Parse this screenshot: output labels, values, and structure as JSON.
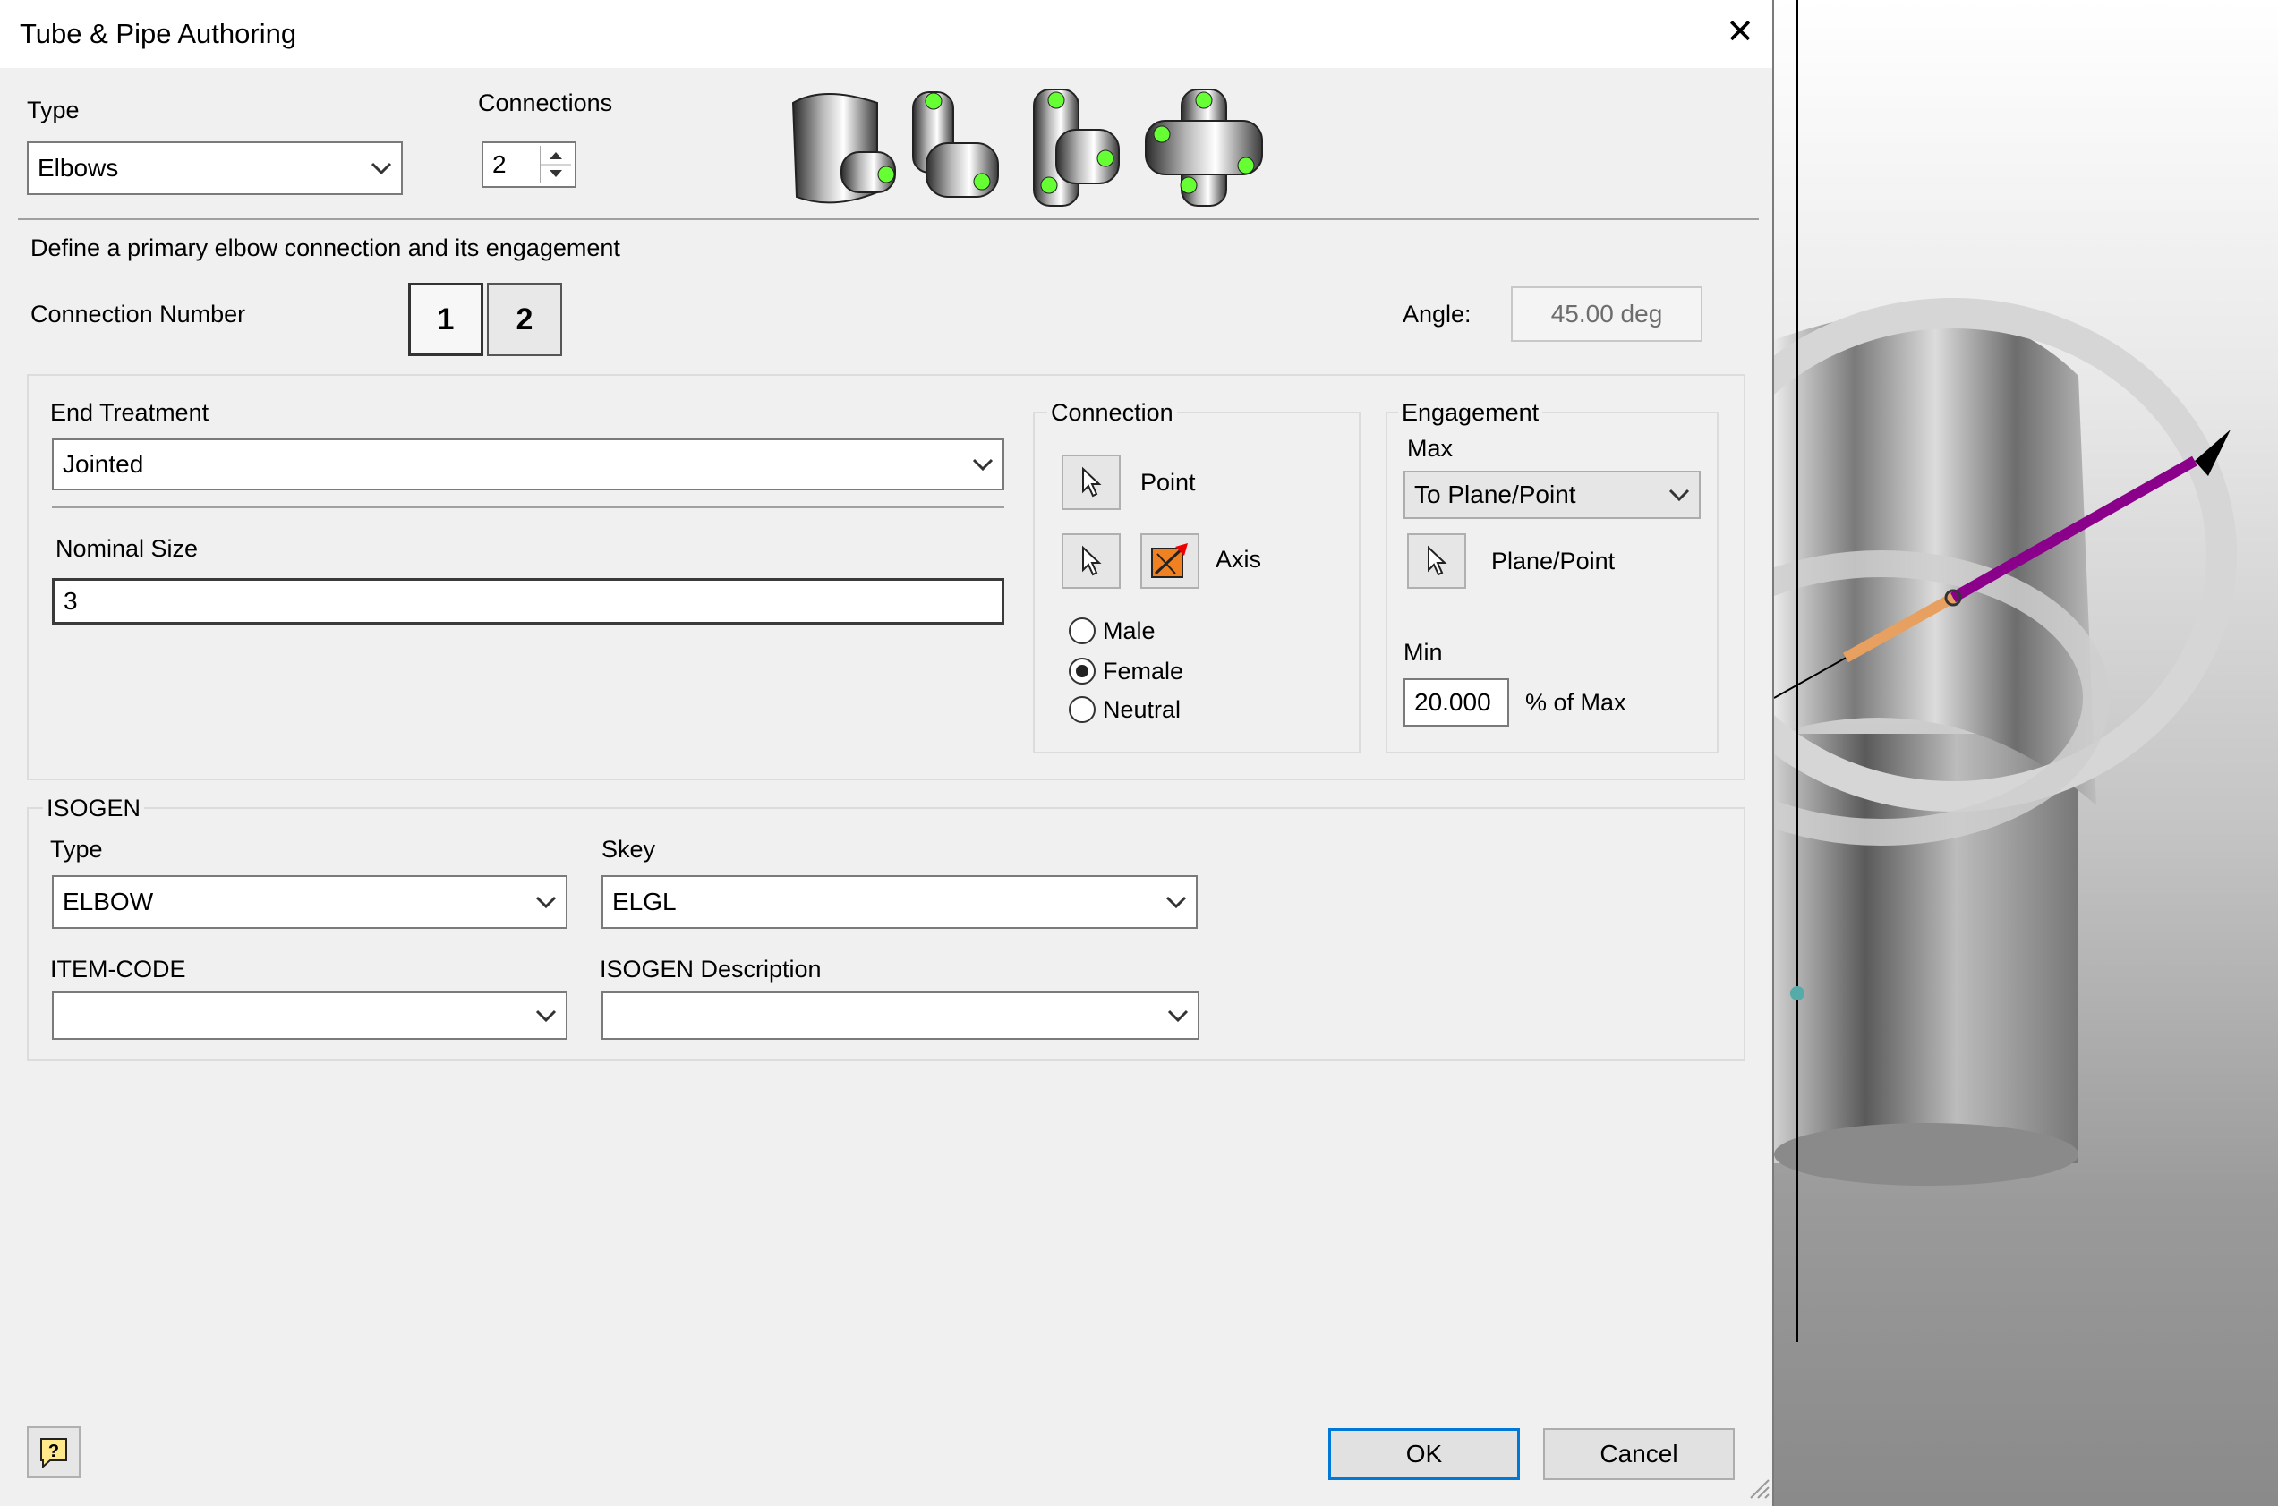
{
  "dialog": {
    "title": "Tube & Pipe Authoring",
    "type_label": "Type",
    "type_value": "Elbows",
    "connections_label": "Connections",
    "connections_value": "2",
    "instruction": "Define a primary elbow connection and its engagement",
    "connection_number_label": "Connection Number",
    "connection_numbers": [
      "1",
      "2"
    ],
    "selected_connection": "1",
    "angle_label": "Angle:",
    "angle_value": "45.00 deg"
  },
  "end_treatment": {
    "label": "End Treatment",
    "value": "Jointed",
    "nominal_size_label": "Nominal Size",
    "nominal_size_value": "3"
  },
  "connection": {
    "label": "Connection",
    "point_label": "Point",
    "axis_label": "Axis",
    "gender_options": [
      "Male",
      "Female",
      "Neutral"
    ],
    "selected_gender": "Female"
  },
  "engagement": {
    "label": "Engagement",
    "max_label": "Max",
    "max_value": "To Plane/Point",
    "plane_point_label": "Plane/Point",
    "min_label": "Min",
    "min_value": "20.000",
    "min_unit": "% of Max"
  },
  "isogen": {
    "label": "ISOGEN",
    "type_label": "Type",
    "type_value": "ELBOW",
    "skey_label": "Skey",
    "skey_value": "ELGL",
    "item_code_label": "ITEM-CODE",
    "item_code_value": "",
    "description_label": "ISOGEN Description",
    "description_value": ""
  },
  "footer": {
    "ok_label": "OK",
    "cancel_label": "Cancel"
  },
  "icons": {
    "fitting_previews": [
      "elbow-45-preview-icon",
      "elbow-90-preview-icon",
      "tee-preview-icon",
      "cross-preview-icon"
    ],
    "help": "help-icon",
    "select": "select-arrow-icon",
    "flip": "flip-axis-icon"
  },
  "colors": {
    "default_button_border": "#0078d7",
    "axis_primary": "#8b008b",
    "axis_secondary": "#e8a060",
    "connection_point": "#66ff33"
  }
}
